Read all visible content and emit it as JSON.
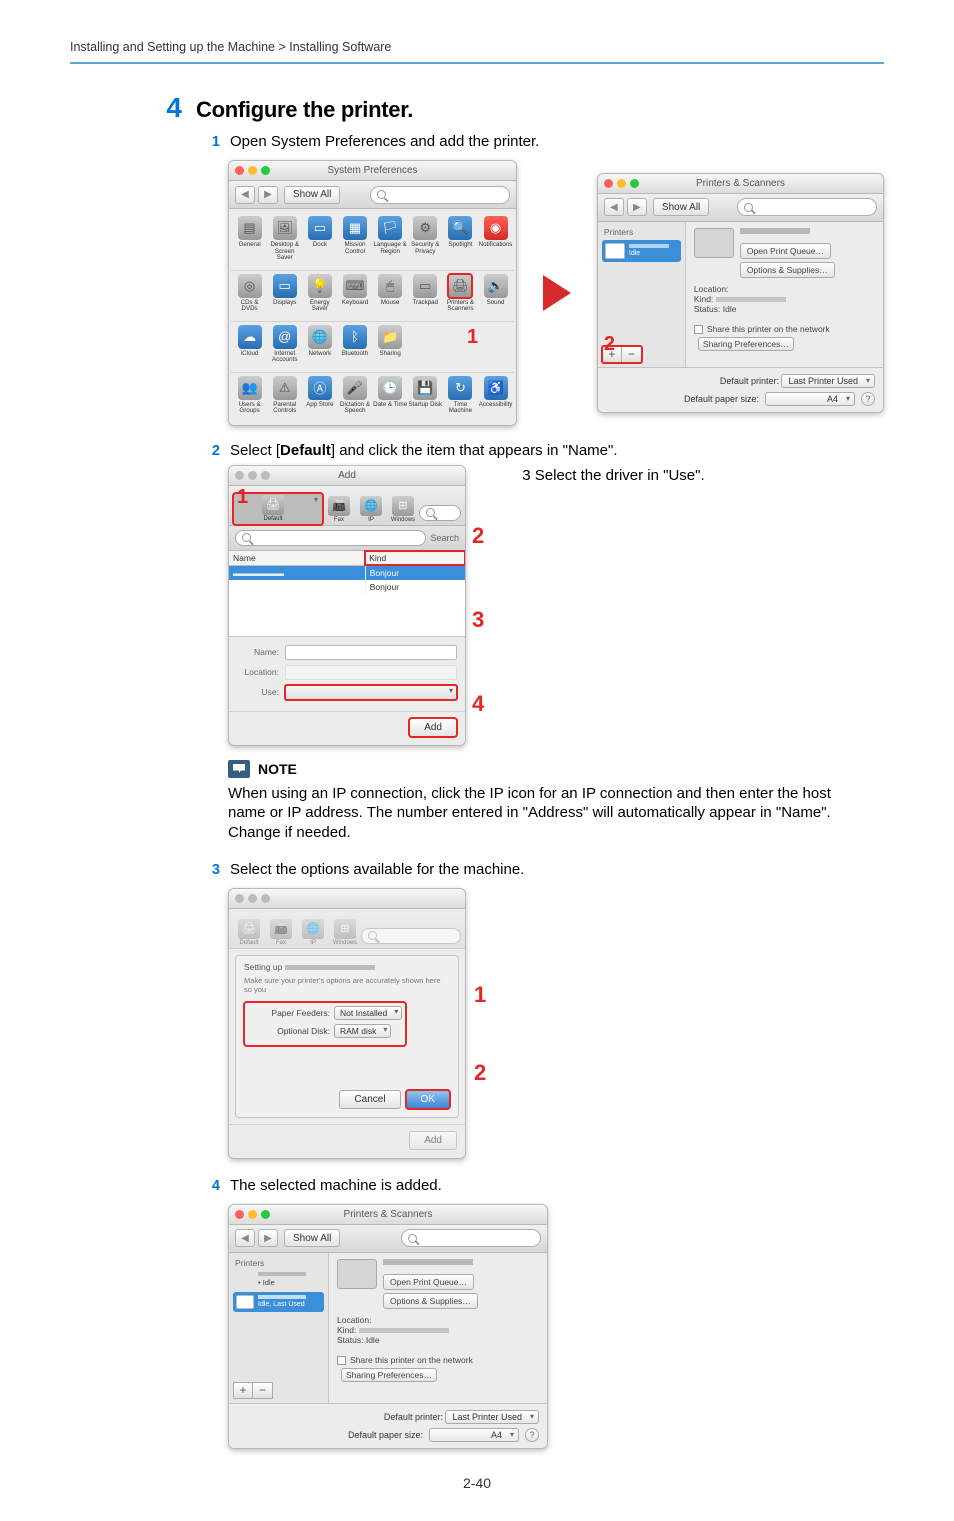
{
  "breadcrumb": "Installing and Setting up the Machine > Installing Software",
  "step4": {
    "num": "4",
    "title": "Configure the printer."
  },
  "substeps": {
    "s1": {
      "num": "1",
      "text": "Open System Preferences and add the printer."
    },
    "s2": {
      "num": "2",
      "text": "Select [Default] and click the item that appears in \"Name\"."
    },
    "s2_side": "3    Select the driver in \"Use\".",
    "s3": {
      "num": "3",
      "text": "Select the options available for the machine."
    },
    "s4": {
      "num": "4",
      "text": "The selected machine is added."
    }
  },
  "sysprefs": {
    "show_all": "Show All",
    "title": "System Preferences",
    "rows": [
      [
        {
          "label": "General",
          "glyph": "▤"
        },
        {
          "label": "Desktop & Screen Saver",
          "glyph": "🖼"
        },
        {
          "label": "Dock",
          "glyph": "▭",
          "blue": true
        },
        {
          "label": "Mission Control",
          "glyph": "▦",
          "blue": true
        },
        {
          "label": "Language & Region",
          "glyph": "🏳",
          "blue": true
        },
        {
          "label": "Security & Privacy",
          "glyph": "⚙"
        },
        {
          "label": "Spotlight",
          "glyph": "🔍",
          "blue": true
        },
        {
          "label": "Notifications",
          "glyph": "◉",
          "red": true
        }
      ],
      [
        {
          "label": "CDs & DVDs",
          "glyph": "◎"
        },
        {
          "label": "Displays",
          "glyph": "▭",
          "blue": true
        },
        {
          "label": "Energy Saver",
          "glyph": "💡"
        },
        {
          "label": "Keyboard",
          "glyph": "⌨"
        },
        {
          "label": "Mouse",
          "glyph": "🖱"
        },
        {
          "label": "Trackpad",
          "glyph": "▭"
        },
        {
          "label": "Printers & Scanners",
          "glyph": "🖨",
          "highlight": true
        },
        {
          "label": "Sound",
          "glyph": "🔊"
        }
      ],
      [
        {
          "label": "iCloud",
          "glyph": "☁",
          "blue": true
        },
        {
          "label": "Internet Accounts",
          "glyph": "@",
          "blue": true
        },
        {
          "label": "Network",
          "glyph": "🌐"
        },
        {
          "label": "Bluetooth",
          "glyph": "ᛒ",
          "blue": true
        },
        {
          "label": "Sharing",
          "glyph": "📁"
        }
      ],
      [
        {
          "label": "Users & Groups",
          "glyph": "👥"
        },
        {
          "label": "Parental Controls",
          "glyph": "⚠"
        },
        {
          "label": "App Store",
          "glyph": "Ⓐ",
          "blue": true
        },
        {
          "label": "Dictation & Speech",
          "glyph": "🎤"
        },
        {
          "label": "Date & Time",
          "glyph": "🕒"
        },
        {
          "label": "Startup Disk",
          "glyph": "💾"
        },
        {
          "label": "Time Machine",
          "glyph": "↻",
          "blue": true
        },
        {
          "label": "Accessibility",
          "glyph": "♿",
          "blue": true
        }
      ]
    ],
    "callout1": "1"
  },
  "printscan": {
    "title": "Printers & Scanners",
    "show_all": "Show All",
    "sidebar_label": "Printers",
    "sidebar_item_status": "Idle",
    "open_queue": "Open Print Queue…",
    "options_supplies": "Options & Supplies…",
    "location_label": "Location:",
    "kind_label": "Kind:",
    "status_label": "Status:",
    "status_value": "Idle",
    "share_label": "Share this printer on the network",
    "share_btn": "Sharing Preferences…",
    "default_printer_label": "Default printer:",
    "default_printer_value": "Last Printer Used",
    "default_paper_label": "Default paper size:",
    "default_paper_value": "A4",
    "callout2": "2",
    "plus": "+",
    "minus": "−"
  },
  "adddlg": {
    "title": "Add",
    "tabs": [
      {
        "id": "default",
        "label": "Default",
        "glyph": "🖨",
        "sel": true
      },
      {
        "id": "fax",
        "label": "Fax",
        "glyph": "📠"
      },
      {
        "id": "ip",
        "label": "IP",
        "glyph": "🌐"
      },
      {
        "id": "windows",
        "label": "Windows",
        "glyph": "⊞"
      }
    ],
    "search_label": "Search",
    "col_name": "Name",
    "col_kind": "Kind",
    "kind_vals": [
      "Kind",
      "Bonjour",
      "Bonjour"
    ],
    "name_label": "Name:",
    "location_label": "Location:",
    "use_label": "Use:",
    "add_btn": "Add",
    "callout1": "1",
    "callout2": "2",
    "callout3": "3",
    "callout4": "4"
  },
  "optdlg": {
    "setting_up": "Setting up ",
    "subtitle": "Make sure your printer's options are accurately shown here so you",
    "row1_label": "Paper Feeders:",
    "row1_value": "Not Installed",
    "row2_label": "Optional Disk:",
    "row2_value": "RAM disk",
    "cancel": "Cancel",
    "ok": "OK",
    "add": "Add",
    "callout1": "1",
    "callout2": "2"
  },
  "printscan2": {
    "sidebar_item1_status": "• Idle",
    "sidebar_item2_status": "Idle, Last Used"
  },
  "note": {
    "label": "NOTE",
    "text": "When using an IP connection, click the IP icon for an IP connection and then enter the host name or IP address. The number entered in \"Address\" will automatically appear in \"Name\". Change if needed."
  },
  "page_number": "2-40"
}
